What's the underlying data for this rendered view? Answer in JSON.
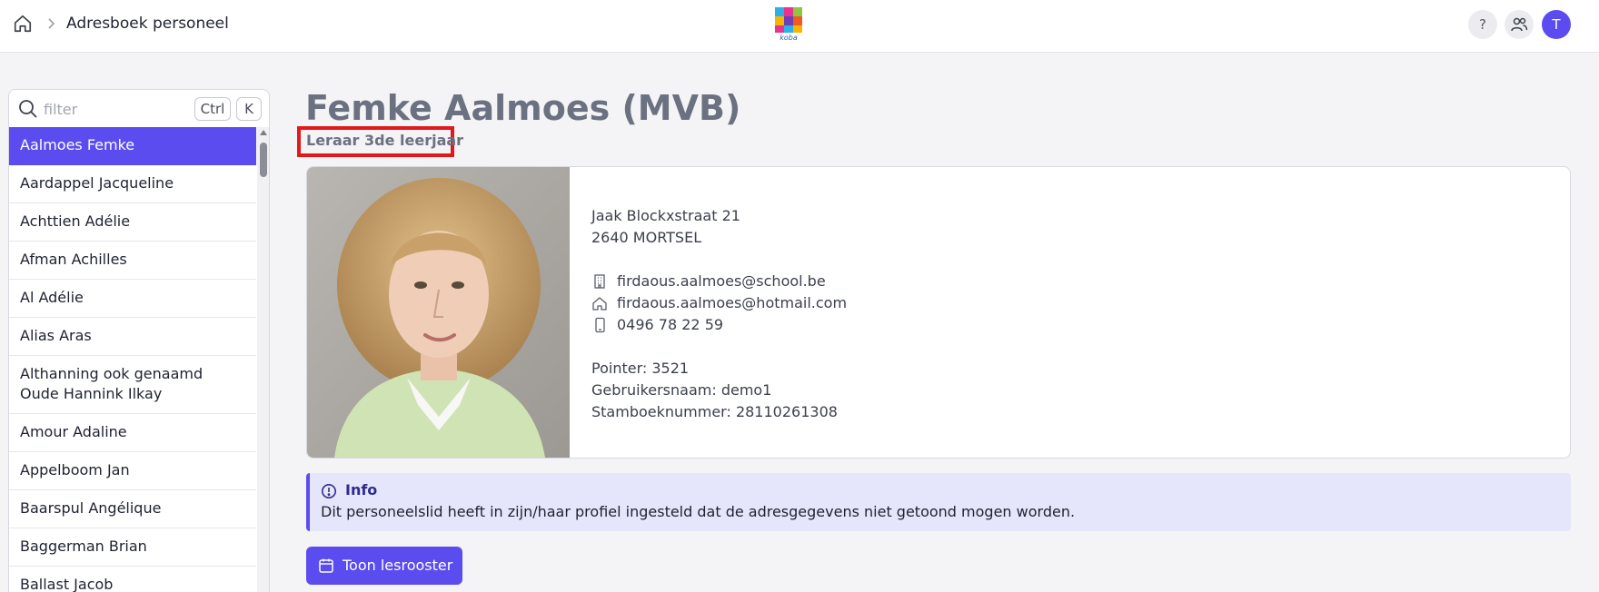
{
  "header": {
    "breadcrumb_title": "Adresboek personeel",
    "logo_text": "koba",
    "help_label": "?",
    "avatar_initial": "T"
  },
  "sidebar": {
    "filter_placeholder": "filter",
    "shortcut_keys": [
      "Ctrl",
      "K"
    ],
    "people": [
      "Aalmoes Femke",
      "Aardappel Jacqueline",
      "Achttien Adélie",
      "Afman Achilles",
      "Al Adélie",
      "Alias Aras",
      "Althanning ook genaamd Oude Hannink Ilkay",
      "Amour Adaline",
      "Appelboom Jan",
      "Baarspul Angélique",
      "Baggerman Brian",
      "Ballast Jacob"
    ],
    "selected": "Aalmoes Femke"
  },
  "profile": {
    "name": "Femke Aalmoes (MVB)",
    "role": "Leraar 3de leerjaar",
    "address_line1": "Jaak Blockxstraat 21",
    "address_line2": "2640 MORTSEL",
    "work_email": "firdaous.aalmoes@school.be",
    "home_email": "firdaous.aalmoes@hotmail.com",
    "phone": "0496 78 22 59",
    "pointer": "Pointer: 3521",
    "username": "Gebruikersnaam: demo1",
    "stamboeknummer": "Stamboeknummer: 28110261308"
  },
  "info": {
    "title": "Info",
    "text": "Dit personeelslid heeft in zijn/haar profiel ingesteld dat de adresgegevens niet getoond mogen worden."
  },
  "actions": {
    "show_schedule": "Toon lesrooster"
  },
  "colors": {
    "accent": "#5b4cf0",
    "highlight_border": "#e0191b",
    "info_bg": "#e5e6fb"
  }
}
